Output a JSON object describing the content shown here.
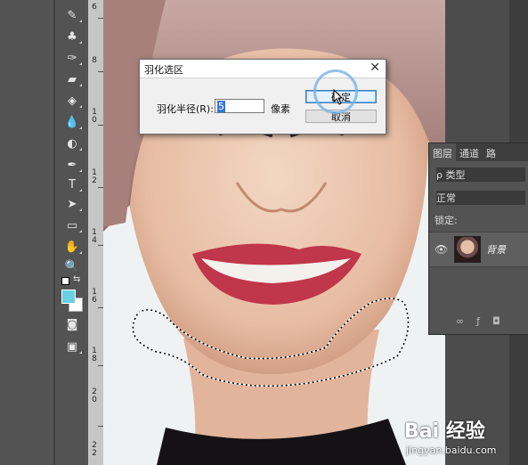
{
  "dialog": {
    "title": "羽化选区",
    "close_glyph": "✕",
    "radius_label": "羽化半径(R):",
    "radius_value": "5",
    "unit": "像素",
    "ok_label": "确定",
    "cancel_label": "取消"
  },
  "layers_panel": {
    "tabs": [
      "图层",
      "通道",
      "路"
    ],
    "filter": "ρ 类型",
    "blend_mode": "正常",
    "lock_label": "锁定:",
    "layer_name": "背景"
  },
  "ruler": {
    "numbers": [
      "6",
      "8",
      "1",
      "0",
      "1",
      "2",
      "1",
      "4",
      "1",
      "6",
      "1",
      "8",
      "2",
      "0",
      "2",
      "2"
    ]
  },
  "watermark": {
    "brand": "Bai  经验",
    "url": "jingyan.baidu.com"
  },
  "colors": {
    "foreground": "#69d0e1",
    "background": "#ffffff",
    "selection_accent": "#3874d8"
  }
}
